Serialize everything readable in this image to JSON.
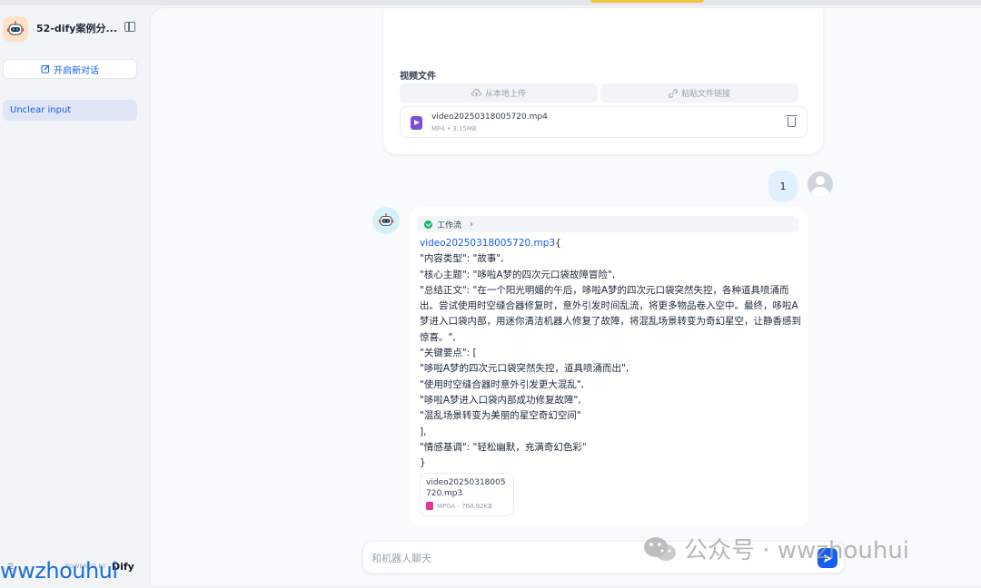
{
  "app": {
    "title": "52-dify案例分...",
    "new_chat_label": "开启新对话",
    "conversations": [
      {
        "label": "Unclear input",
        "active": true
      }
    ],
    "powered_by": "POWERED BY",
    "brand": "Dify"
  },
  "input_card": {
    "video_label": "视频文件",
    "upload_local_label": "从本地上传",
    "paste_link_label": "粘贴文件链接",
    "file": {
      "name": "video20250318005720.mp4",
      "meta": "MP4 • 3.15MB",
      "icon": "video-file-icon"
    }
  },
  "user_message": {
    "text": "1"
  },
  "bot_message": {
    "workflow_label": "工作流",
    "workflow_status": "success",
    "link_text": "video20250318005720.mp3",
    "body": "{\n\"内容类型\": \"故事\",\n\"核心主题\": \"哆啦A梦的四次元口袋故障冒险\",\n\"总结正文\": \"在一个阳光明媚的午后，哆啦A梦的四次元口袋突然失控，各种道具喷涌而出。尝试使用时空缝合器修复时，意外引发时间乱流，将更多物品卷入空中。最终，哆啦A梦进入口袋内部，用迷你清洁机器人修复了故障，将混乱场景转变为奇幻星空，让静香感到惊喜。\",\n\"关键要点\": [\n\"哆啦A梦的四次元口袋突然失控，道具喷涌而出\",\n\"使用时空缝合器时意外引发更大混乱\",\n\"哆啦A梦进入口袋内部成功修复故障\",\n\"混乱场景转变为美丽的星空奇幻空间\"\n],\n\"情感基调\": \"轻松幽默，充满奇幻色彩\"\n}",
    "attachment": {
      "name": "video20250318005720.mp3",
      "meta": "MPGA · 768.92KB",
      "icon": "audio-file-icon"
    }
  },
  "chat_input": {
    "placeholder": "和机器人聊天",
    "send_icon": "send-icon"
  },
  "watermarks": {
    "right": "公众号 · wwzhouhui",
    "left": "wwzhouhui"
  },
  "colors": {
    "accent": "#155eef",
    "success": "#12b76a",
    "video_icon": "#7c4ddb",
    "audio_icon": "#e6349a"
  }
}
